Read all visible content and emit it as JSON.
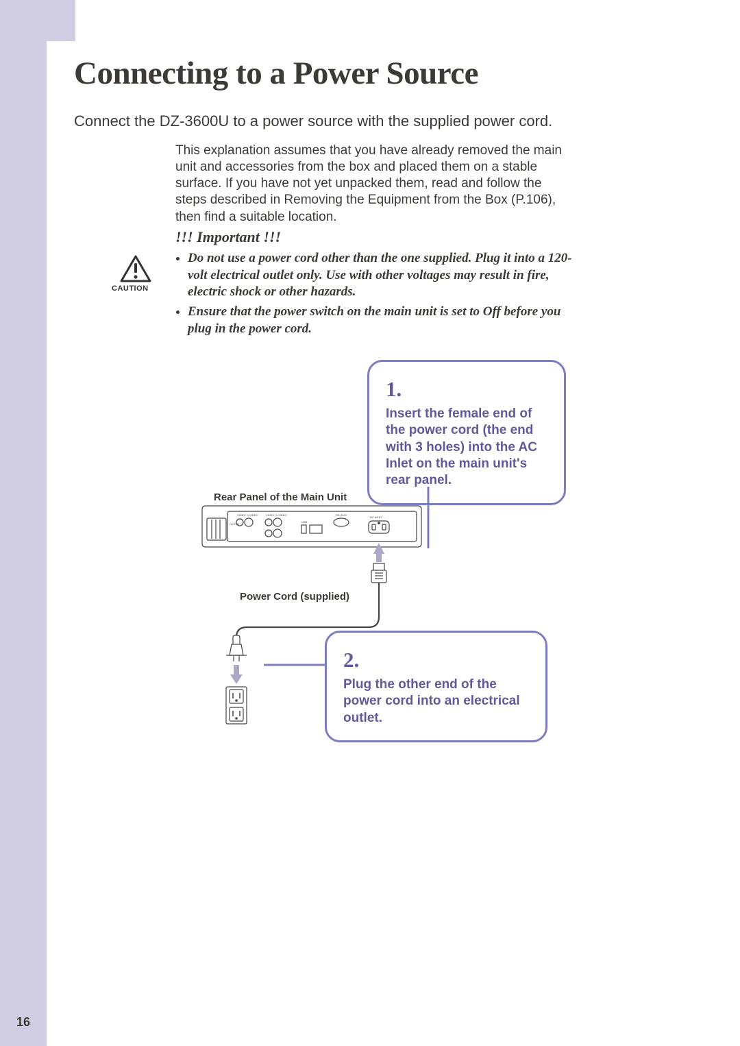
{
  "title": "Connecting to a Power Source",
  "intro": "Connect the DZ-3600U to a power source with the supplied power cord.",
  "explanation": "This explanation assumes that you have already removed the main unit and accessories from the box and placed them on a stable surface. If you have not yet unpacked them, read and follow the steps described in Removing the Equipment from the Box (P.106), then find a suitable location.",
  "caution_label": "CAUTION",
  "important": {
    "heading": "!!! Important !!!",
    "bullets": [
      "Do not use a power cord other than the one supplied. Plug it into a 120-volt electrical outlet only. Use with other voltages may result in fire, electric shock or other hazards.",
      "Ensure that the power switch on the main unit is set to Off before you plug in the power cord."
    ]
  },
  "callouts": [
    {
      "num": "1.",
      "text": "Insert the female end of the power cord (the end with 3 holes) into the AC Inlet on the main unit's rear panel."
    },
    {
      "num": "2.",
      "text": "Plug the other end of the power cord into an electrical outlet."
    }
  ],
  "diagram_labels": {
    "rear_panel": "Rear Panel of the Main Unit",
    "power_cord": "Power Cord (supplied)",
    "ac_inlet": "AC INLET",
    "video": "VIDEO",
    "s_video": "S-VIDEO",
    "rs232c": "RS-232C",
    "output": "OUTPUT",
    "usb": "USB"
  },
  "page_number": "16",
  "colors": {
    "accent": "#7c7dbf",
    "accent_text": "#605b98",
    "sidebar": "#d0cde2"
  }
}
